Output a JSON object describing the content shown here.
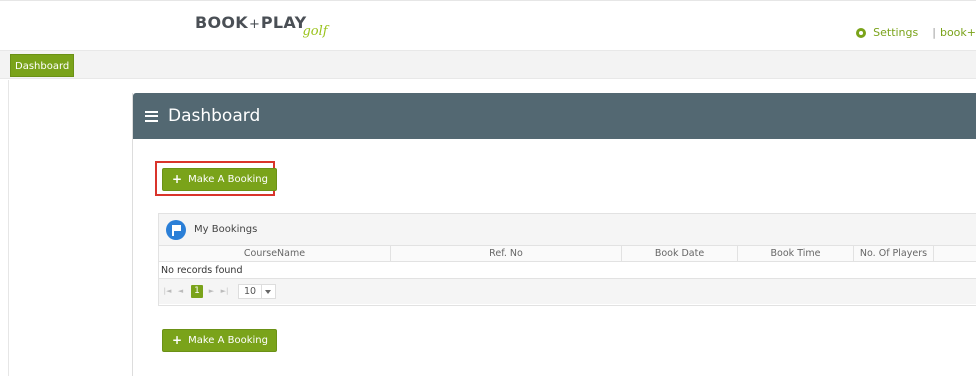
{
  "header": {
    "logo_main": "BOOK",
    "logo_plus": "+",
    "logo_play": "PLAY",
    "logo_sub": "golf",
    "settings_label": "Settings",
    "separator": "|",
    "user_link": "book+"
  },
  "nav": {
    "active_tab": "Dashboard"
  },
  "panel": {
    "title": "Dashboard",
    "make_booking_label": "Make A Booking",
    "make_booking_label_bottom": "Make A Booking"
  },
  "grid": {
    "caption": "My Bookings",
    "columns": [
      "CourseName",
      "Ref. No",
      "Book Date",
      "Book Time",
      "No. Of Players",
      ""
    ],
    "empty_message": "No records found",
    "pager": {
      "current_page": "1",
      "rows_per_page": "10"
    }
  },
  "colors": {
    "accent_green": "#7aa31a",
    "panel_header": "#536872",
    "highlight_red": "#d9342b",
    "flag_blue": "#2b7fd7"
  }
}
